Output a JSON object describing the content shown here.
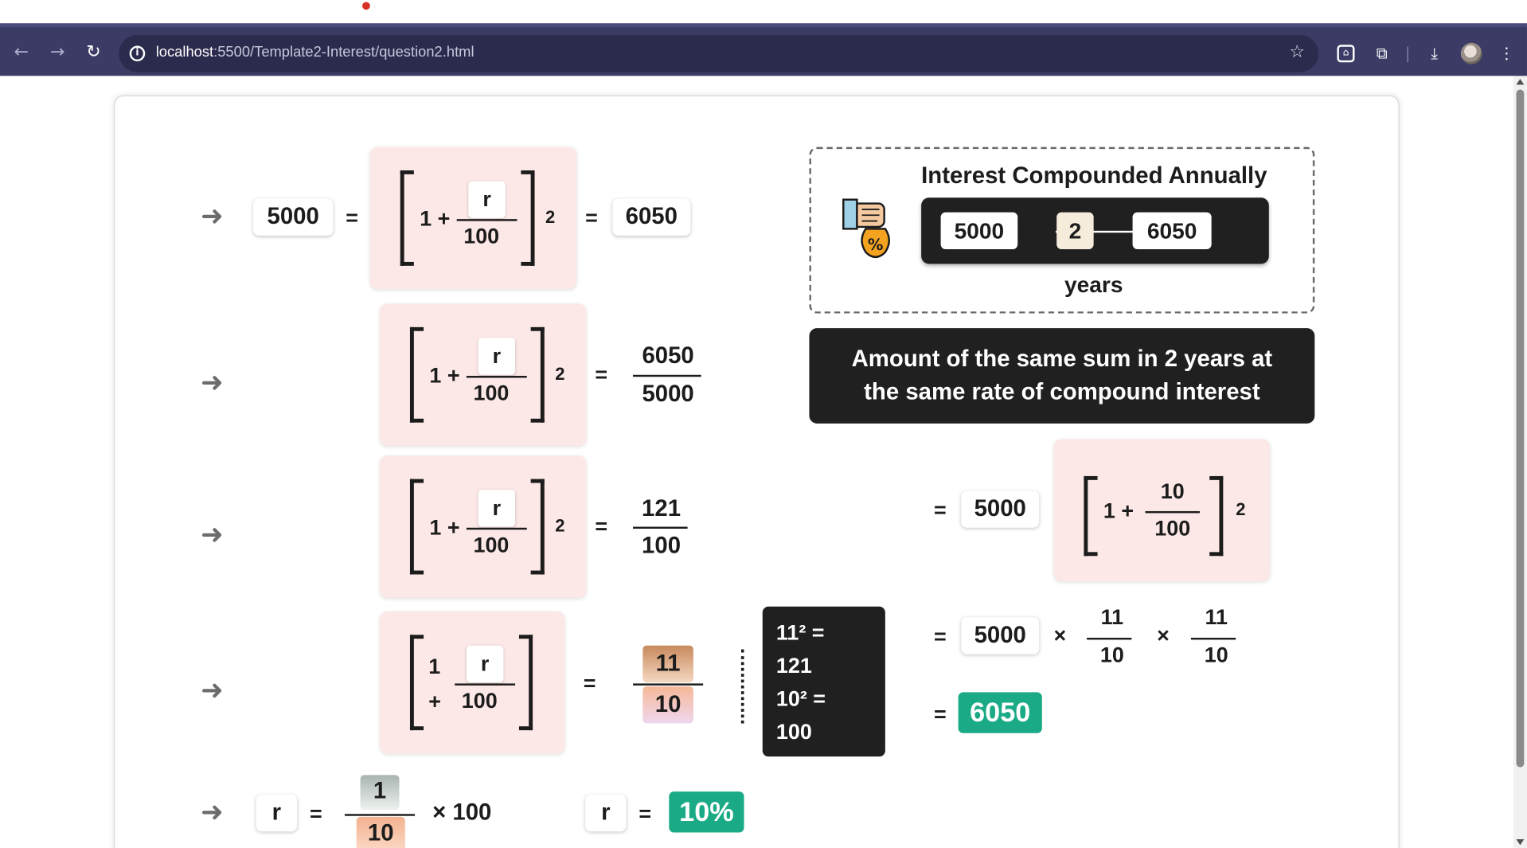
{
  "browser": {
    "url_host": "localhost",
    "url_path": ":5500/Template2-Interest/question2.html",
    "icons": [
      "back-icon",
      "forward-icon",
      "reload-icon",
      "site-info-icon",
      "bookmark-star-icon",
      "extension-icon",
      "puzzle-icon",
      "download-icon",
      "profile-avatar",
      "menu-kebab-icon"
    ]
  },
  "colors": {
    "toolbar": "#3b3b66",
    "card_pink": "#fce8e6",
    "dark_panel": "#202020",
    "answer_green": "#1aaa86"
  },
  "steps": [
    {
      "arrow": "➜",
      "principal": "5000",
      "eq1": "=",
      "one_plus": "1 +",
      "r": "r",
      "denom": "100",
      "power": "2",
      "eq2": "=",
      "amount": "6050"
    },
    {
      "arrow": "➜",
      "one_plus": "1 +",
      "r": "r",
      "denom": "100",
      "power": "2",
      "eq": "=",
      "rhs_num": "6050",
      "rhs_den": "5000"
    },
    {
      "arrow": "➜",
      "one_plus": "1 +",
      "r": "r",
      "denom": "100",
      "power": "2",
      "eq": "=",
      "rhs_num": "121",
      "rhs_den": "100"
    },
    {
      "arrow": "➜",
      "one": "1",
      "plus": "+",
      "r": "r",
      "denom": "100",
      "eq": "=",
      "rhs_num": "11",
      "rhs_den": "10",
      "calc_lines": [
        "11² =",
        "121",
        "10² =",
        "100"
      ]
    },
    {
      "arrow": "➜",
      "r_label": "r",
      "eq": "=",
      "num": "1",
      "den": "10",
      "times": "× 100",
      "r_label2": "r",
      "eq2": "=",
      "answer": "10%"
    }
  ],
  "info_box": {
    "title": "Interest Compounded Annually",
    "principal": "5000",
    "years": "2",
    "amount": "6050",
    "years_label": "years",
    "icon": "hand-money-bag-percent-icon",
    "percent_symbol": "%"
  },
  "question_banner": {
    "line1": "Amount of the same sum in 2 years at",
    "line2": "the same rate of compound interest"
  },
  "verification": {
    "eq1": "=",
    "principal": "5000",
    "one_plus": "1 +",
    "num": "10",
    "den": "100",
    "power": "2",
    "eq2": "=",
    "principal2": "5000",
    "times1": "×",
    "f1_num": "11",
    "f1_den": "10",
    "times2": "×",
    "f2_num": "11",
    "f2_den": "10",
    "eq3": "=",
    "result": "6050"
  }
}
